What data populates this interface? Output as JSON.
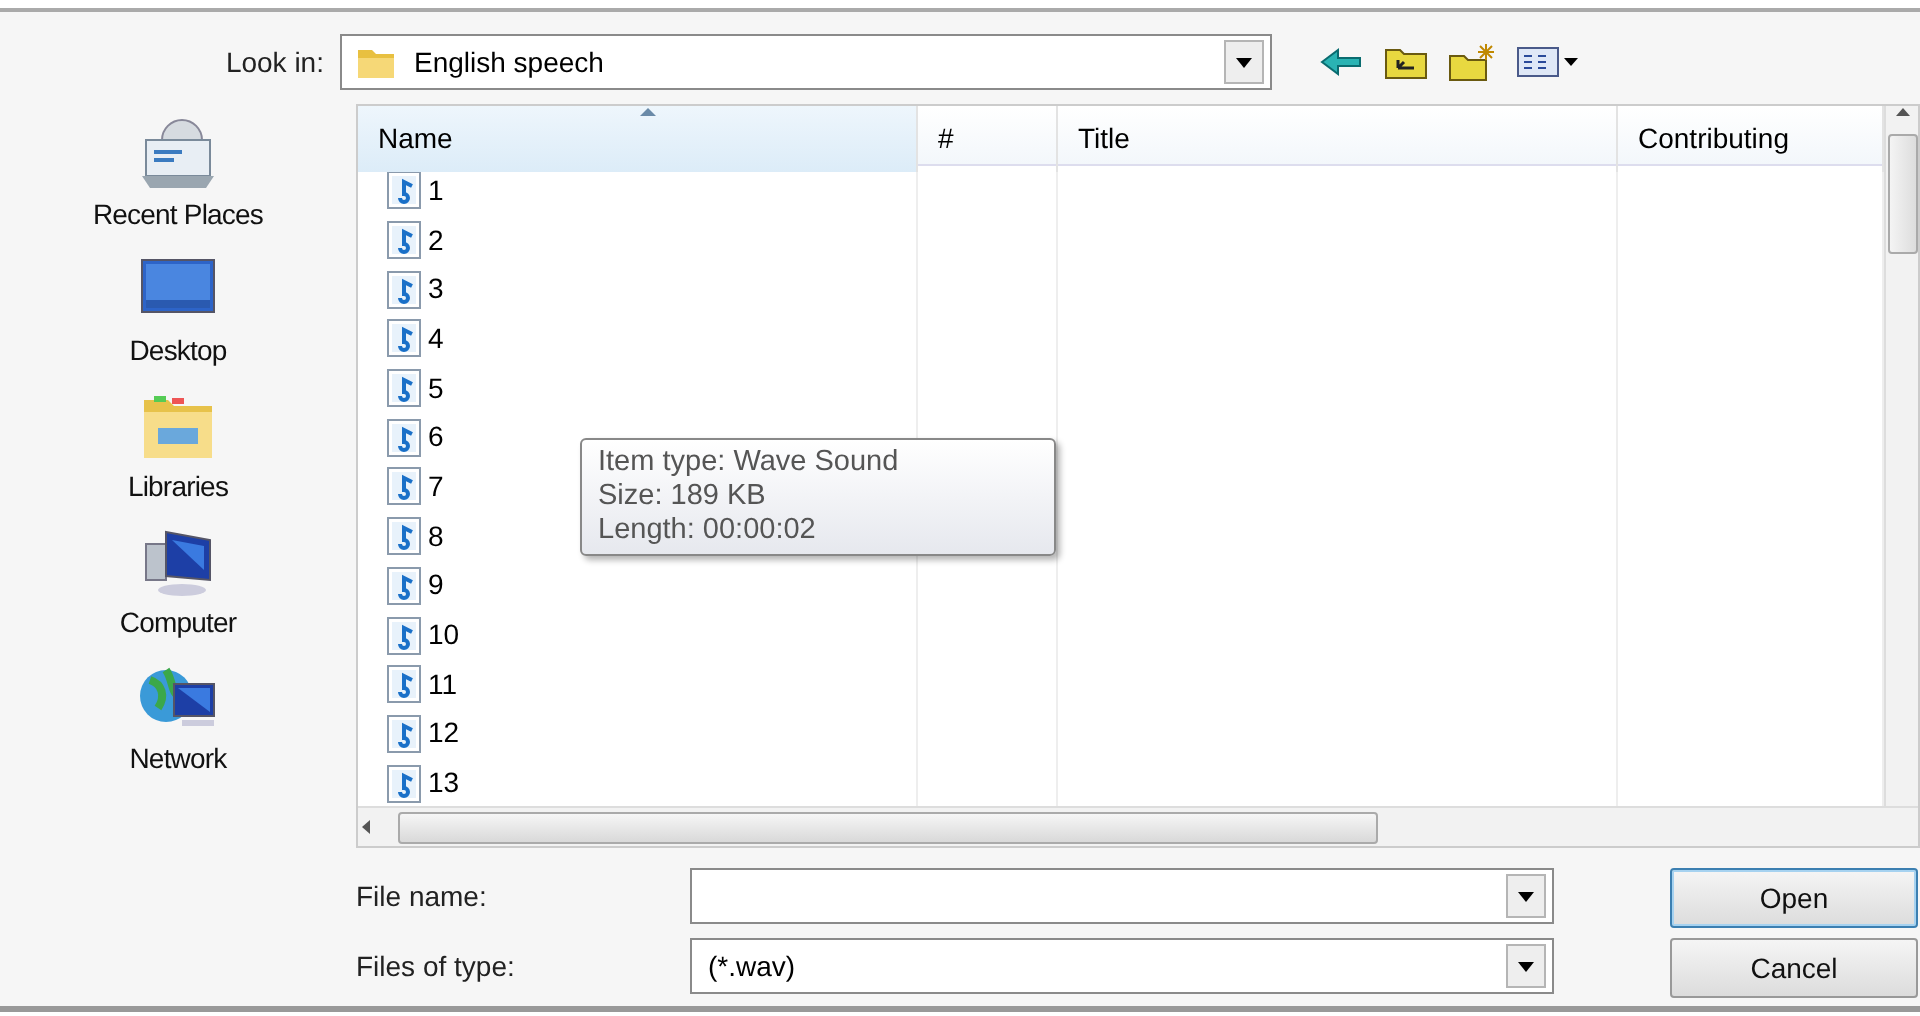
{
  "look_in": {
    "label": "Look in:",
    "value": "English speech"
  },
  "places": [
    {
      "label": "Recent Places",
      "kind": "recent"
    },
    {
      "label": "Desktop",
      "kind": "desktop"
    },
    {
      "label": "Libraries",
      "kind": "libraries"
    },
    {
      "label": "Computer",
      "kind": "computer"
    },
    {
      "label": "Network",
      "kind": "network"
    }
  ],
  "columns": [
    {
      "label": "Name",
      "sorted": true
    },
    {
      "label": "#",
      "sorted": false
    },
    {
      "label": "Title",
      "sorted": false
    },
    {
      "label": "Contributing",
      "sorted": false
    }
  ],
  "files": [
    {
      "name": "1"
    },
    {
      "name": "2"
    },
    {
      "name": "3"
    },
    {
      "name": "4"
    },
    {
      "name": "5"
    },
    {
      "name": "6"
    },
    {
      "name": "7"
    },
    {
      "name": "8"
    },
    {
      "name": "9"
    },
    {
      "name": "10"
    },
    {
      "name": "11"
    },
    {
      "name": "12"
    },
    {
      "name": "13"
    }
  ],
  "tooltip": {
    "lines": [
      "Item type: Wave Sound",
      "Size: 189 KB",
      "Length: 00:00:02"
    ]
  },
  "file_name": {
    "label": "File name:"
  },
  "file_type": {
    "label": "Files of type:",
    "value": "(*.wav)"
  },
  "buttons": [
    {
      "label": "Open",
      "default": true
    },
    {
      "label": "Cancel",
      "default": false
    }
  ]
}
